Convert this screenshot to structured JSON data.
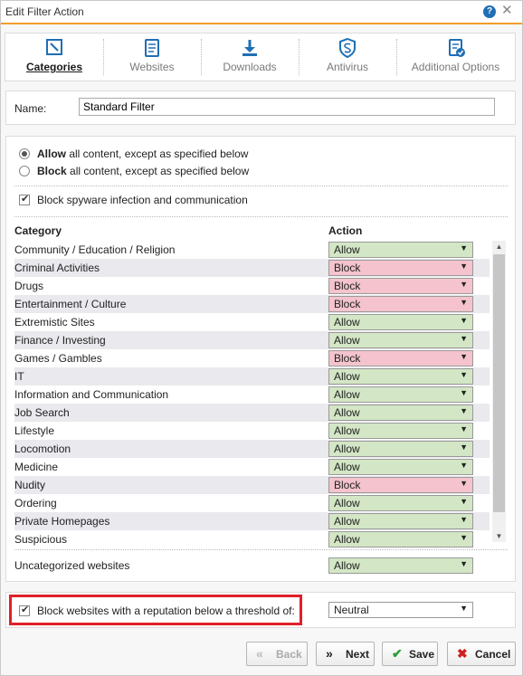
{
  "window": {
    "title": "Edit Filter Action",
    "help_icon": "?",
    "close_icon": "✕"
  },
  "tabs": [
    {
      "label": "Categories",
      "icon": "categories-icon",
      "active": true
    },
    {
      "label": "Websites",
      "icon": "websites-icon"
    },
    {
      "label": "Downloads",
      "icon": "downloads-icon"
    },
    {
      "label": "Antivirus",
      "icon": "antivirus-icon"
    },
    {
      "label": "Additional Options",
      "icon": "additional-options-icon"
    }
  ],
  "name": {
    "label": "Name:",
    "value": "Standard Filter"
  },
  "mode": {
    "allow_bold": "Allow",
    "allow_rest": " all content, except as specified below",
    "block_bold": "Block",
    "block_rest": " all content, except as specified below",
    "selected": "allow"
  },
  "spyware": {
    "label": "Block spyware infection and communication",
    "checked": true
  },
  "table": {
    "col_category": "Category",
    "col_action": "Action",
    "rows": [
      {
        "category": "Community / Education / Religion",
        "action": "Allow"
      },
      {
        "category": "Criminal Activities",
        "action": "Block"
      },
      {
        "category": "Drugs",
        "action": "Block"
      },
      {
        "category": "Entertainment / Culture",
        "action": "Block"
      },
      {
        "category": "Extremistic Sites",
        "action": "Allow"
      },
      {
        "category": "Finance / Investing",
        "action": "Allow"
      },
      {
        "category": "Games / Gambles",
        "action": "Block"
      },
      {
        "category": "IT",
        "action": "Allow"
      },
      {
        "category": "Information and Communication",
        "action": "Allow"
      },
      {
        "category": "Job Search",
        "action": "Allow"
      },
      {
        "category": "Lifestyle",
        "action": "Allow"
      },
      {
        "category": "Locomotion",
        "action": "Allow"
      },
      {
        "category": "Medicine",
        "action": "Allow"
      },
      {
        "category": "Nudity",
        "action": "Block"
      },
      {
        "category": "Ordering",
        "action": "Allow"
      },
      {
        "category": "Private Homepages",
        "action": "Allow"
      },
      {
        "category": "Suspicious",
        "action": "Allow"
      }
    ],
    "dropdown_arrow": "▼",
    "scroll_up": "▲",
    "scroll_down": "▼"
  },
  "uncategorized": {
    "label": "Uncategorized websites",
    "action": "Allow"
  },
  "reputation": {
    "label": "Block websites with a reputation below a threshold of:",
    "checked": true,
    "value": "Neutral"
  },
  "buttons": {
    "back": "Back",
    "back_icon": "«",
    "next": "Next",
    "next_icon": "»",
    "save": "Save",
    "save_icon": "✔",
    "cancel": "Cancel",
    "cancel_icon": "✖"
  },
  "colors": {
    "accent": "#f39c2a",
    "allow": "#d3e6c5",
    "block": "#f4c3cd",
    "highlight": "#e0202a",
    "icon_blue": "#1f6fb5"
  }
}
